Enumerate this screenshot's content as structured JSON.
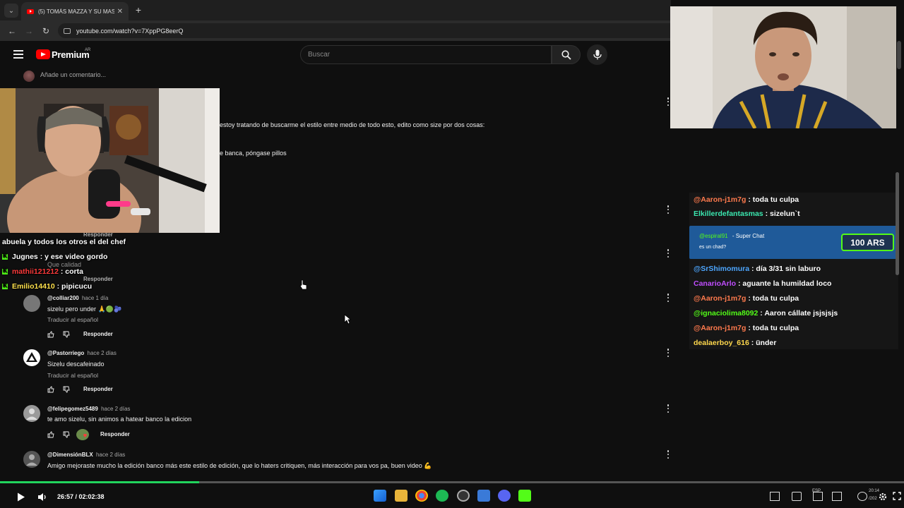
{
  "browser": {
    "tab_title": "(5) TOMÁS MAZZA Y SU MASC",
    "url": "youtube.com/watch?v=7XppPG8eerQ"
  },
  "youtube": {
    "brand": "Premium",
    "country": "AR",
    "search_placeholder": "Buscar",
    "add_comment_placeholder": "Añade un comentario..."
  },
  "partial_comment": {
    "line1": "estoy tratando de buscarme el estilo entre medio de todo esto, edito como size por dos cosas:",
    "line2": "e banca, póngase pillos"
  },
  "hidden_comment": {
    "reply": "Responder",
    "body": "Que calidad",
    "reply2": "Responder"
  },
  "overlay_chat": [
    {
      "user": "",
      "text": "abuela y todos los otros el del chef"
    },
    {
      "user": "Jugnes",
      "text": ": y ese video gordo",
      "color": "#ffffff"
    },
    {
      "user": "mathii121212",
      "text": ": corta",
      "color": "#ff3b3b"
    },
    {
      "user": "Emilio14410",
      "text": ": pipicucu",
      "color": "#ffe14d"
    }
  ],
  "comments": [
    {
      "author": "@colliar200",
      "when": "hace 1 día",
      "body": "sizelu pero under 🙏🟢🫐",
      "translate": "Traducir al español",
      "reply": "Responder"
    },
    {
      "author": "@Pastorriego",
      "when": "hace 2 días",
      "body": "Sizelu descafeinado",
      "translate": "Traducir al español",
      "reply": "Responder"
    },
    {
      "author": "@felipegomez5489",
      "when": "hace 2 días",
      "body": "te amo sizelu, sin animos a hatear banco la edicion",
      "translate": "",
      "reply": "Responder"
    },
    {
      "author": "@DimensiónBLX",
      "when": "hace 2 días",
      "body": "Amigo mejoraste mucho la edición banco más este estilo de edición, que lo haters critiquen, más interacción para vos pa, buen video 💪",
      "translate": "",
      "reply": "Responder"
    }
  ],
  "kick_chat": [
    {
      "user": "@Aaron-j1m7g",
      "text": ": toda tu culpa",
      "color": "#ff7a4d"
    },
    {
      "user": "Elkillerdefantasmas",
      "text": ": sizelun`t",
      "color": "#3be8b0"
    },
    {
      "user": "@SrShimomura",
      "text": ": día 3/31 sin laburo",
      "color": "#4da6ff"
    },
    {
      "user": "CanarioArlo",
      "text": ": aguante la humildad loco",
      "color": "#c04dff"
    },
    {
      "user": "@Aaron-j1m7g",
      "text": ": toda tu culpa",
      "color": "#ff7a4d"
    },
    {
      "user": "@ignaciolima8092",
      "text": ": Aaron cállate jsjsjsjs",
      "color": "#53fc18"
    },
    {
      "user": "@Aaron-j1m7g",
      "text": ": toda tu culpa",
      "color": "#ff7a4d"
    },
    {
      "user": "dealaerboy_616",
      "text": ": ünder",
      "color": "#ffd84d"
    }
  ],
  "superchat": {
    "user": "@espiral91",
    "label": "- Super Chat",
    "message": "es un chad?",
    "amount": "100 ARS"
  },
  "player": {
    "time": "26:57 / 02:02:38",
    "progress": 0.22
  },
  "taskbar": {
    "lang": "ESP",
    "clock": "20:14",
    "date": "/202"
  }
}
